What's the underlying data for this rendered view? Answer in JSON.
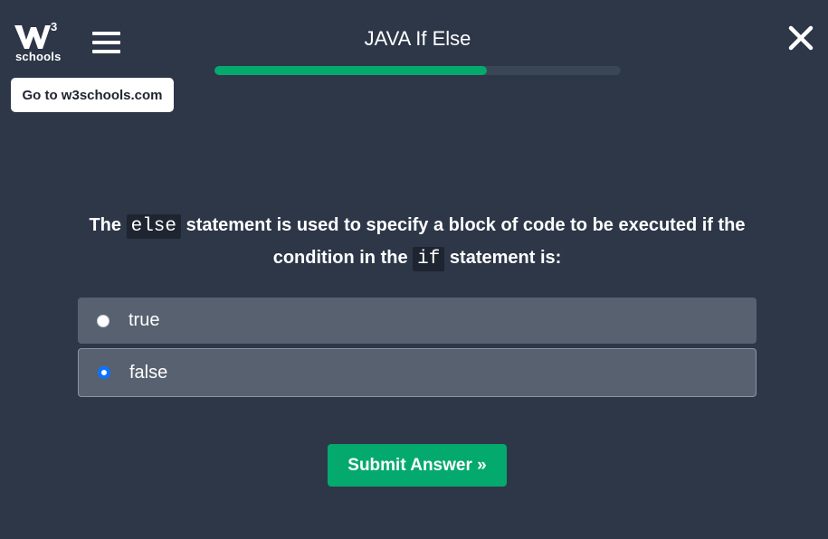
{
  "header": {
    "logo_text": "schools",
    "logo_superscript": "3",
    "goto_button_label": "Go to w3schools.com",
    "title": "JAVA If Else",
    "progress_fraction": 0.67
  },
  "question": {
    "part1": "The ",
    "code1": "else",
    "part2": " statement is used to specify a block of code to be executed if the condition in the ",
    "code2": "if",
    "part3": " statement is:"
  },
  "options": [
    {
      "label": "true",
      "selected": false
    },
    {
      "label": "false",
      "selected": true
    }
  ],
  "submit_label": "Submit Answer »",
  "colors": {
    "background": "#2d3748",
    "accent": "#04aa6d",
    "option_bg": "#586170",
    "radio_checked": "#0a74ff"
  },
  "icons": {
    "logo": "w3schools-logo-icon",
    "menu": "hamburger-menu-icon",
    "close": "close-icon"
  }
}
